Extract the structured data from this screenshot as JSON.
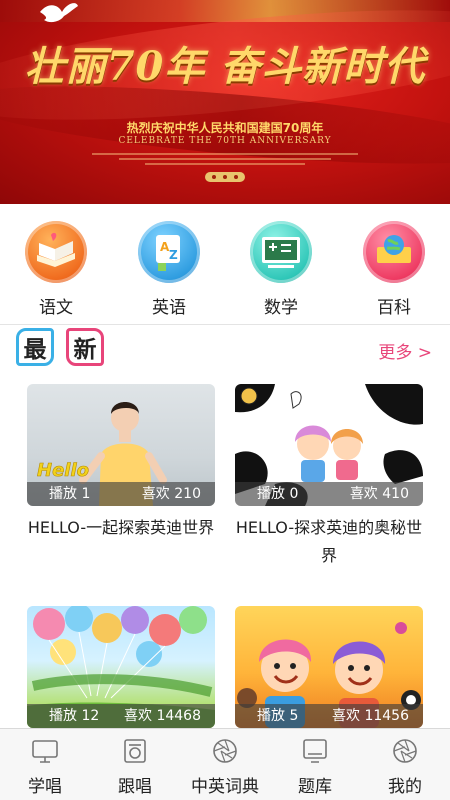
{
  "banner": {
    "headline": "壮丽70年 奋斗新时代",
    "subline": "热烈庆祝中华人民共和国建国70周年",
    "english": "CELEBRATE THE 70TH ANNIVERSARY"
  },
  "categories": [
    {
      "label": "语文",
      "icon": "book-icon"
    },
    {
      "label": "英语",
      "icon": "abc-letters-icon"
    },
    {
      "label": "数学",
      "icon": "chalkboard-icon"
    },
    {
      "label": "百科",
      "icon": "globe-book-icon"
    }
  ],
  "latest": {
    "char1": "最",
    "char2": "新",
    "more": "更多 >"
  },
  "videos": [
    {
      "plays_label": "播放",
      "plays": "1",
      "likes_label": "喜欢",
      "likes": "210",
      "title": "HELLO-一起探索英迪世界"
    },
    {
      "plays_label": "播放",
      "plays": "0",
      "likes_label": "喜欢",
      "likes": "410",
      "title": "HELLO-探求英迪的奥秘世界"
    },
    {
      "plays_label": "播放",
      "plays": "12",
      "likes_label": "喜欢",
      "likes": "14468",
      "title": ""
    },
    {
      "plays_label": "播放",
      "plays": "5",
      "likes_label": "喜欢",
      "likes": "11456",
      "title": ""
    }
  ],
  "thumb_text": {
    "hello": "Hello"
  },
  "nav": [
    {
      "label": "学唱",
      "icon": "tv-icon"
    },
    {
      "label": "跟唱",
      "icon": "radio-icon"
    },
    {
      "label": "中英词典",
      "icon": "camera-aperture-icon"
    },
    {
      "label": "题库",
      "icon": "monitor-icon"
    },
    {
      "label": "我的",
      "icon": "camera-aperture-icon"
    }
  ],
  "colors": {
    "accent": "#e8457a",
    "latest_blue": "#3ab0e6",
    "banner_red": "#c3120f",
    "banner_gold": "#ffd86a"
  }
}
